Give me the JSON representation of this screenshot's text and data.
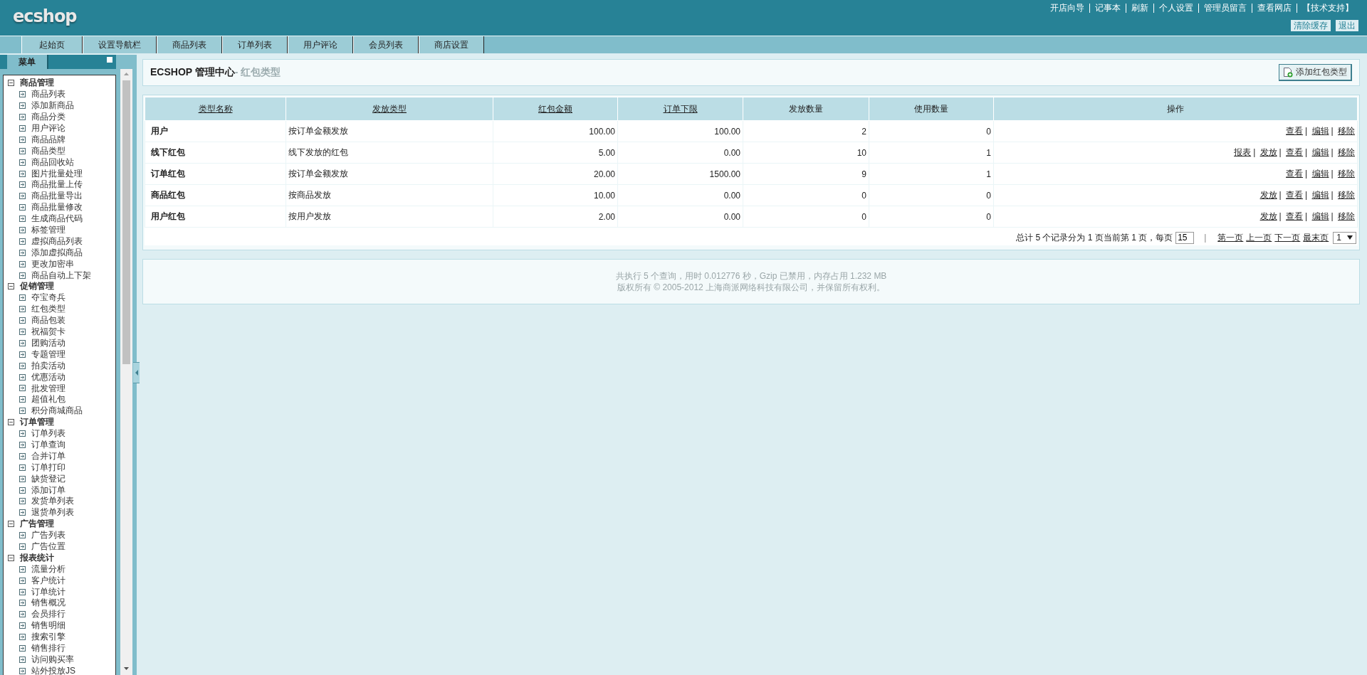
{
  "header": {
    "logo": "ecshop",
    "top_links": [
      "开店向导",
      "记事本",
      "刷新",
      "个人设置",
      "管理员留言",
      "查看网店",
      "【技术支持】"
    ],
    "buttons": [
      "清除缓存",
      "退出"
    ]
  },
  "nav_tabs": [
    "起始页",
    "设置导航栏",
    "商品列表",
    "订单列表",
    "用户评论",
    "会员列表",
    "商店设置"
  ],
  "sidebar": {
    "title": "菜单",
    "groups": [
      {
        "label": "商品管理",
        "expanded": true,
        "children": [
          "商品列表",
          "添加新商品",
          "商品分类",
          "用户评论",
          "商品品牌",
          "商品类型",
          "商品回收站",
          "图片批量处理",
          "商品批量上传",
          "商品批量导出",
          "商品批量修改",
          "生成商品代码",
          "标签管理",
          "虚拟商品列表",
          "添加虚拟商品",
          "更改加密串",
          "商品自动上下架"
        ]
      },
      {
        "label": "促销管理",
        "expanded": true,
        "children": [
          "夺宝奇兵",
          "红包类型",
          "商品包装",
          "祝福贺卡",
          "团购活动",
          "专题管理",
          "拍卖活动",
          "优惠活动",
          "批发管理",
          "超值礼包",
          "积分商城商品"
        ]
      },
      {
        "label": "订单管理",
        "expanded": true,
        "children": [
          "订单列表",
          "订单查询",
          "合并订单",
          "订单打印",
          "缺货登记",
          "添加订单",
          "发货单列表",
          "退货单列表"
        ]
      },
      {
        "label": "广告管理",
        "expanded": true,
        "children": [
          "广告列表",
          "广告位置"
        ]
      },
      {
        "label": "报表统计",
        "expanded": true,
        "children": [
          "流量分析",
          "客户统计",
          "订单统计",
          "销售概况",
          "会员排行",
          "销售明细",
          "搜索引擎",
          "销售排行",
          "访问购买率",
          "站外投放JS"
        ]
      }
    ]
  },
  "page_heading": {
    "title": "ECSHOP 管理中心",
    "subtitle": "- 红包类型",
    "action_button": "添加红包类型"
  },
  "table": {
    "columns": [
      {
        "label": "类型名称",
        "sortable": true
      },
      {
        "label": "发放类型",
        "sortable": true
      },
      {
        "label": "红包金额",
        "sortable": true
      },
      {
        "label": "订单下限",
        "sortable": true
      },
      {
        "label": "发放数量",
        "sortable": false
      },
      {
        "label": "使用数量",
        "sortable": false
      },
      {
        "label": "操作",
        "sortable": false
      }
    ],
    "rows": [
      {
        "name": "用户",
        "send_type": "按订单金额发放",
        "amount": "100.00",
        "min_order": "100.00",
        "sent": "2",
        "used": "0",
        "actions": [
          "查看",
          "编辑",
          "移除"
        ]
      },
      {
        "name": "线下红包",
        "send_type": "线下发放的红包",
        "amount": "5.00",
        "min_order": "0.00",
        "sent": "10",
        "used": "1",
        "actions": [
          "报表",
          "发放",
          "查看",
          "编辑",
          "移除"
        ]
      },
      {
        "name": "订单红包",
        "send_type": "按订单金额发放",
        "amount": "20.00",
        "min_order": "1500.00",
        "sent": "9",
        "used": "1",
        "actions": [
          "查看",
          "编辑",
          "移除"
        ]
      },
      {
        "name": "商品红包",
        "send_type": "按商品发放",
        "amount": "10.00",
        "min_order": "0.00",
        "sent": "0",
        "used": "0",
        "actions": [
          "发放",
          "查看",
          "编辑",
          "移除"
        ]
      },
      {
        "name": "用户红包",
        "send_type": "按用户发放",
        "amount": "2.00",
        "min_order": "0.00",
        "sent": "0",
        "used": "0",
        "actions": [
          "发放",
          "查看",
          "编辑",
          "移除"
        ]
      }
    ],
    "separator": "|"
  },
  "pagination": {
    "summary": "总计 5 个记录分为 1 页当前第 1 页，每页",
    "page_size": "15",
    "links": [
      "第一页",
      "上一页",
      "下一页",
      "最末页"
    ],
    "page_select": "1",
    "divider": "|"
  },
  "footer": [
    "共执行 5 个查询，用时 0.012776 秒，Gzip 已禁用，内存占用 1.232 MB",
    "版权所有 © 2005-2012 上海商派网络科技有限公司，并保留所有权利。"
  ]
}
